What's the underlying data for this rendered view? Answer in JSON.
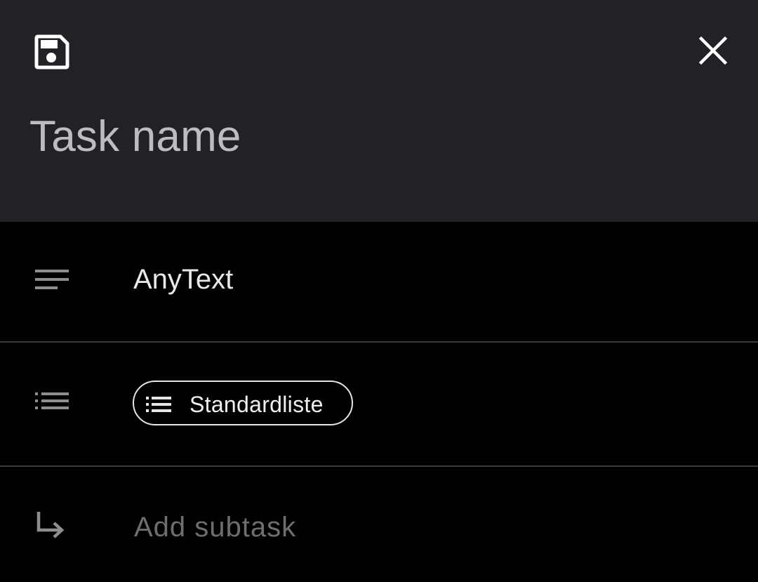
{
  "header": {
    "save_icon": "save-icon",
    "close_icon": "close-icon",
    "task_name": {
      "placeholder": "Task name",
      "value": ""
    }
  },
  "description": {
    "icon": "notes-icon",
    "text": "AnyText"
  },
  "list": {
    "icon": "list-icon",
    "chip_icon": "list-icon",
    "chip_label": "Standardliste"
  },
  "subtask": {
    "icon": "subdirectory-arrow-right-icon",
    "placeholder": "Add subtask"
  },
  "colors": {
    "header_background": "#212226",
    "body_background": "#000000",
    "divider": "#3a3a3d",
    "muted_text": "#6e6e72"
  }
}
